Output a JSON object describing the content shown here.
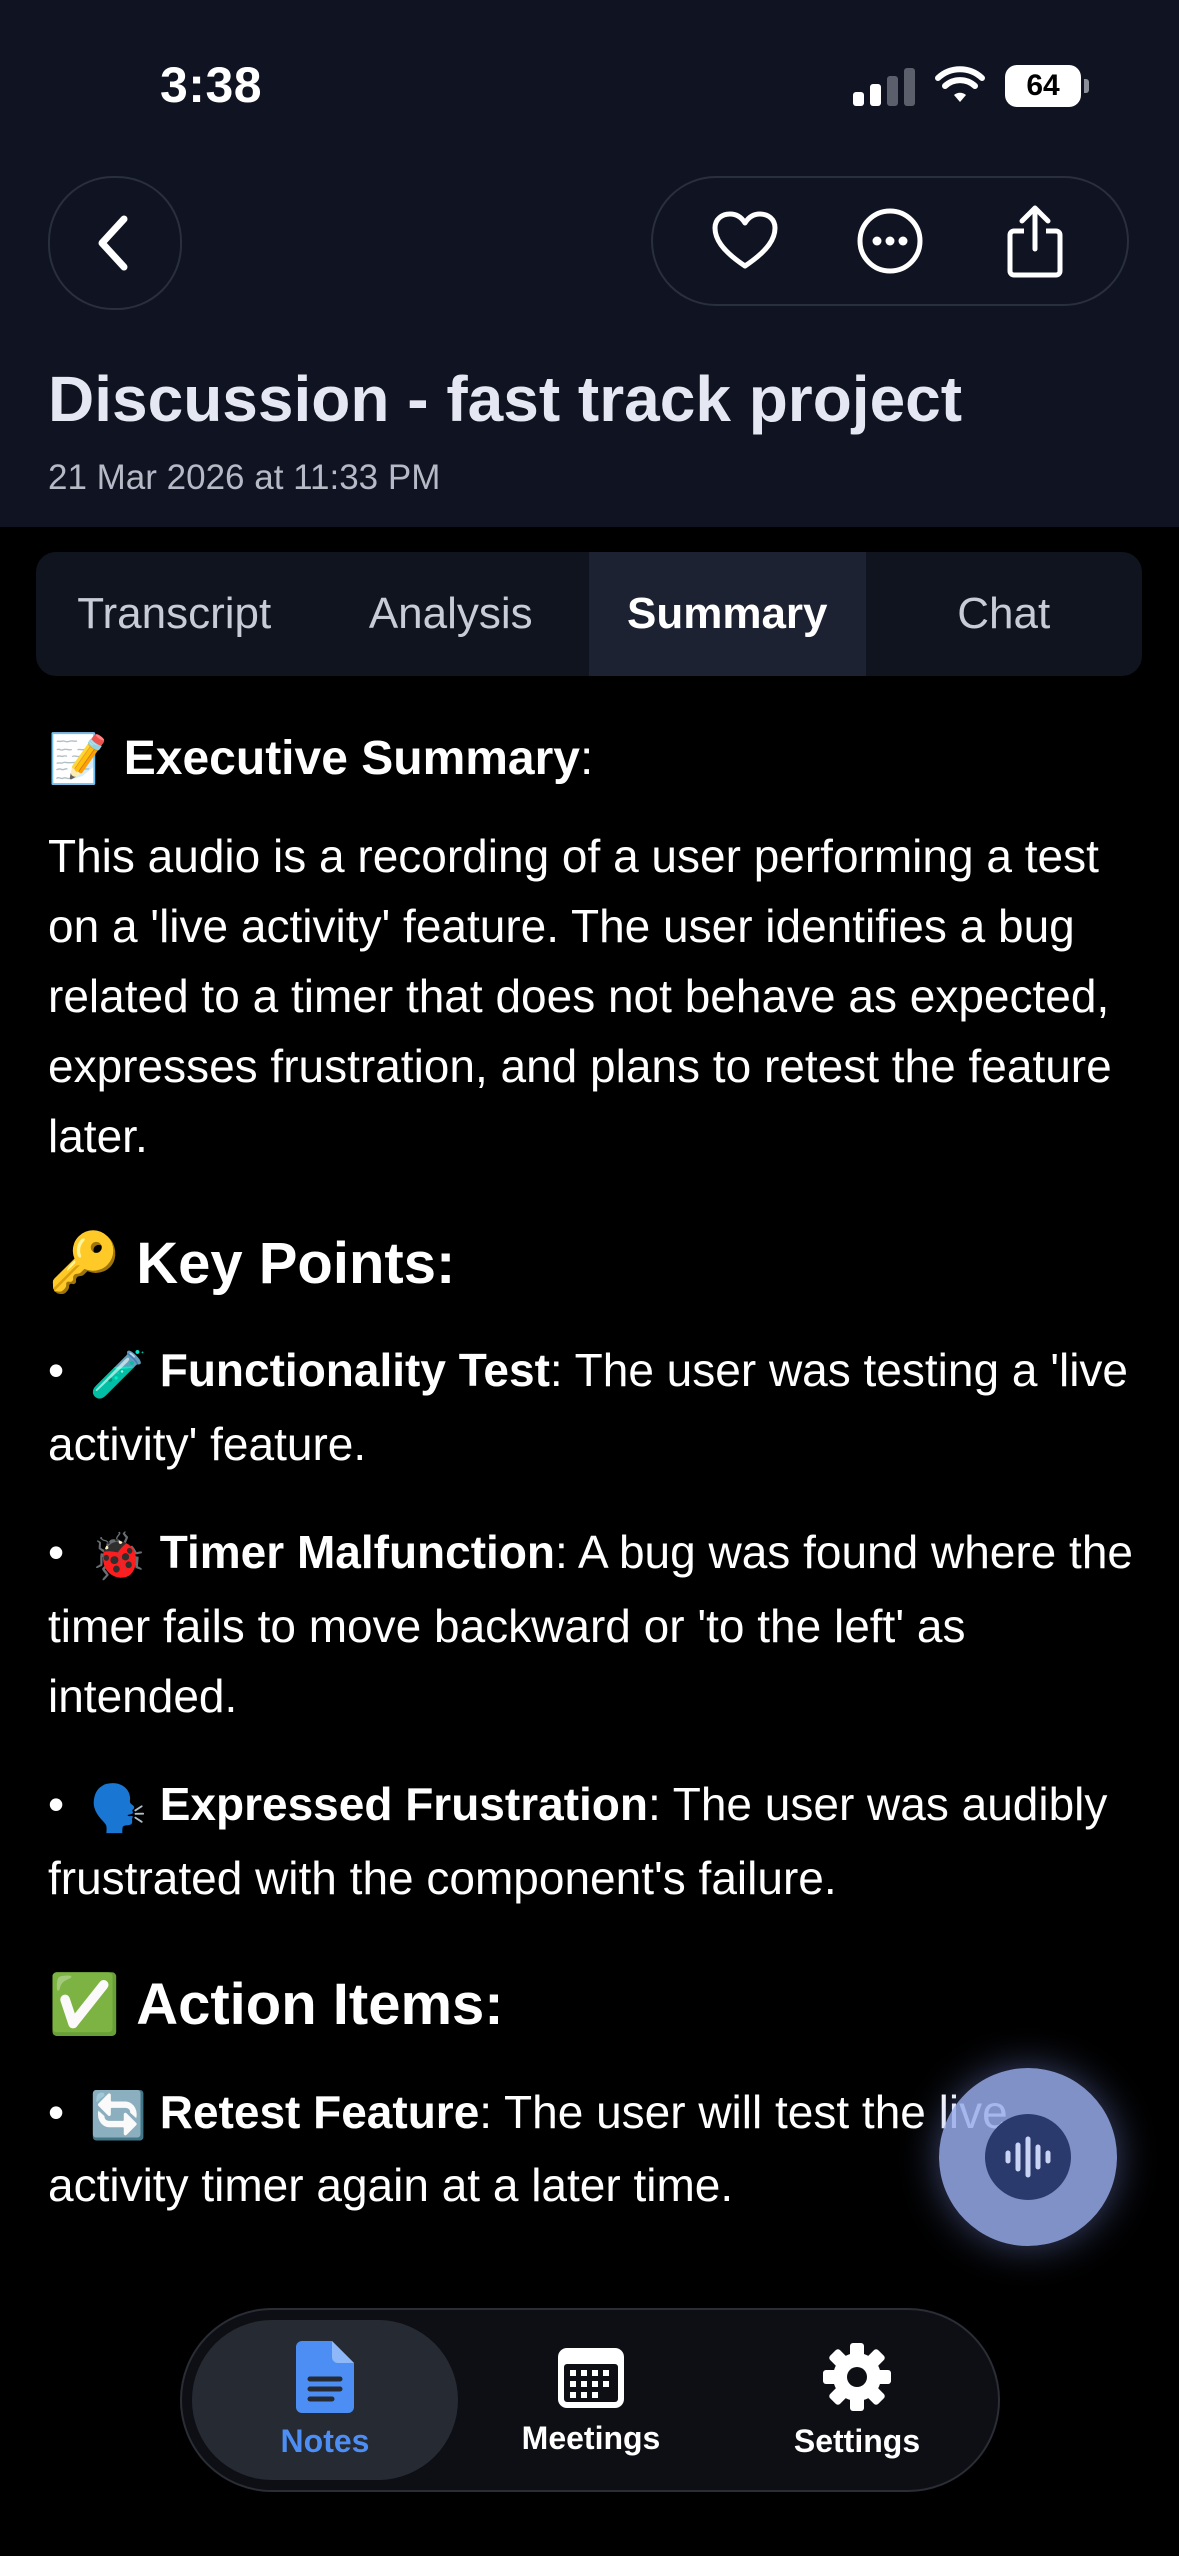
{
  "status_bar": {
    "time": "3:38",
    "battery": "64"
  },
  "header": {
    "title": "Discussion - fast track project",
    "date": "21 Mar 2026 at 11:33 PM"
  },
  "icons": {
    "back": "chevron-left-icon",
    "favorite": "heart-icon",
    "more": "ellipsis-circle-icon",
    "share": "share-icon"
  },
  "tabs": [
    {
      "label": "Transcript"
    },
    {
      "label": "Analysis"
    },
    {
      "label": "Summary",
      "active": true
    },
    {
      "label": "Chat"
    }
  ],
  "summary": {
    "executive": {
      "emoji": "📝",
      "heading": "Executive Summary",
      "suffix": ":",
      "text": "This audio is a recording of a user performing a test on a 'live activity' feature. The user identifies a bug related to a timer that does not behave as expected, expresses frustration, and plans to retest the feature later."
    },
    "key_points": {
      "emoji": "🔑",
      "heading": "Key Points:",
      "items": [
        {
          "emoji": "🧪",
          "title": "Functionality Test",
          "text": ": The user was testing a 'live activity' feature."
        },
        {
          "emoji": "🐞",
          "title": "Timer Malfunction",
          "text": ": A bug was found where the timer fails to move backward or 'to the left' as intended."
        },
        {
          "emoji": "🗣️",
          "title": "Expressed Frustration",
          "text": ": The user was audibly frustrated with the component's failure."
        }
      ]
    },
    "action_items": {
      "emoji": "✅",
      "heading": "Action Items:",
      "items": [
        {
          "emoji": "🔄",
          "title": "Retest Feature",
          "text": ": The user will test the live activity timer again at a later time."
        }
      ]
    }
  },
  "bottom_nav": [
    {
      "label": "Notes",
      "icon": "document-icon",
      "active": true
    },
    {
      "label": "Meetings",
      "icon": "calendar-icon"
    },
    {
      "label": "Settings",
      "icon": "gear-icon"
    }
  ],
  "colors": {
    "accent": "#4c8ef4",
    "header_bg": "#0f1322",
    "fab": "#96aaeb"
  }
}
